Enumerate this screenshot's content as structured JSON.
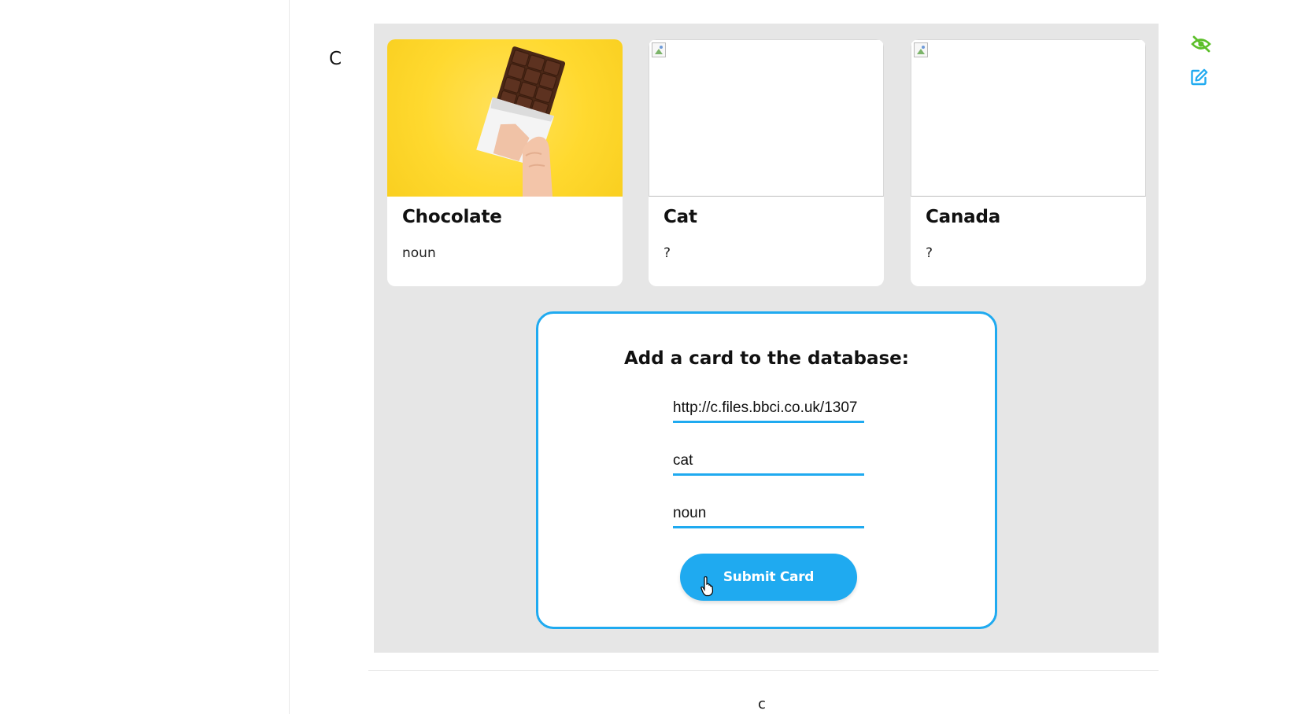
{
  "sidebar": {
    "letter": "C"
  },
  "cards": [
    {
      "title": "Chocolate",
      "subtitle": "noun",
      "image": "chocolate-bar-photo"
    },
    {
      "title": "Cat",
      "subtitle": "?",
      "image": "broken-image"
    },
    {
      "title": "Canada",
      "subtitle": "?",
      "image": "broken-image"
    }
  ],
  "form": {
    "title": "Add a card to the database:",
    "image_url_value": "http://c.files.bbci.co.uk/1307",
    "word_value": "cat",
    "type_value": "noun",
    "submit_label": "Submit Card"
  },
  "footer": {
    "letter": "c"
  },
  "colors": {
    "accent": "#1faaf0",
    "hide_icon": "#5cbf2a",
    "edit_icon": "#1faaf0",
    "cell_bg": "#e6e6e6"
  },
  "icons": {
    "hide": "eye-slash-icon",
    "edit": "edit-icon"
  }
}
